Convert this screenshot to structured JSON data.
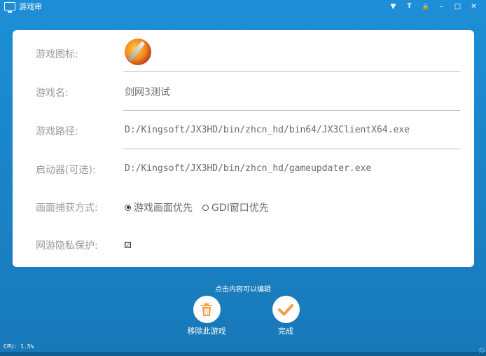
{
  "window": {
    "title": "游戏串",
    "controls": [
      "▼",
      "T",
      "🔒",
      "–",
      "□",
      "✕"
    ]
  },
  "form": {
    "icon_label": "游戏图标:",
    "name_label": "游戏名:",
    "name_value": "剑网3测试",
    "path_label": "游戏路径:",
    "path_value": "D:/Kingsoft/JX3HD/bin/zhcn_hd/bin64/JX3ClientX64.exe",
    "launcher_label": "启动器(可选):",
    "launcher_value": "D:/Kingsoft/JX3HD/bin/zhcn_hd/gameupdater.exe",
    "capture_label": "画面捕获方式:",
    "capture_options": [
      "游戏画面优先",
      "GDI窗口优先"
    ],
    "capture_selected": 0,
    "privacy_label": "网游隐私保护:",
    "privacy_checked": true,
    "privacy_mark": "☑"
  },
  "footer": {
    "hint": "点击内容可以编辑",
    "remove_label": "移除此游戏",
    "done_label": "完成",
    "cpu": "CPU: 1.5%"
  },
  "colors": {
    "accent_orange": "#f0a04a",
    "background_blue": "#1a82c4"
  }
}
